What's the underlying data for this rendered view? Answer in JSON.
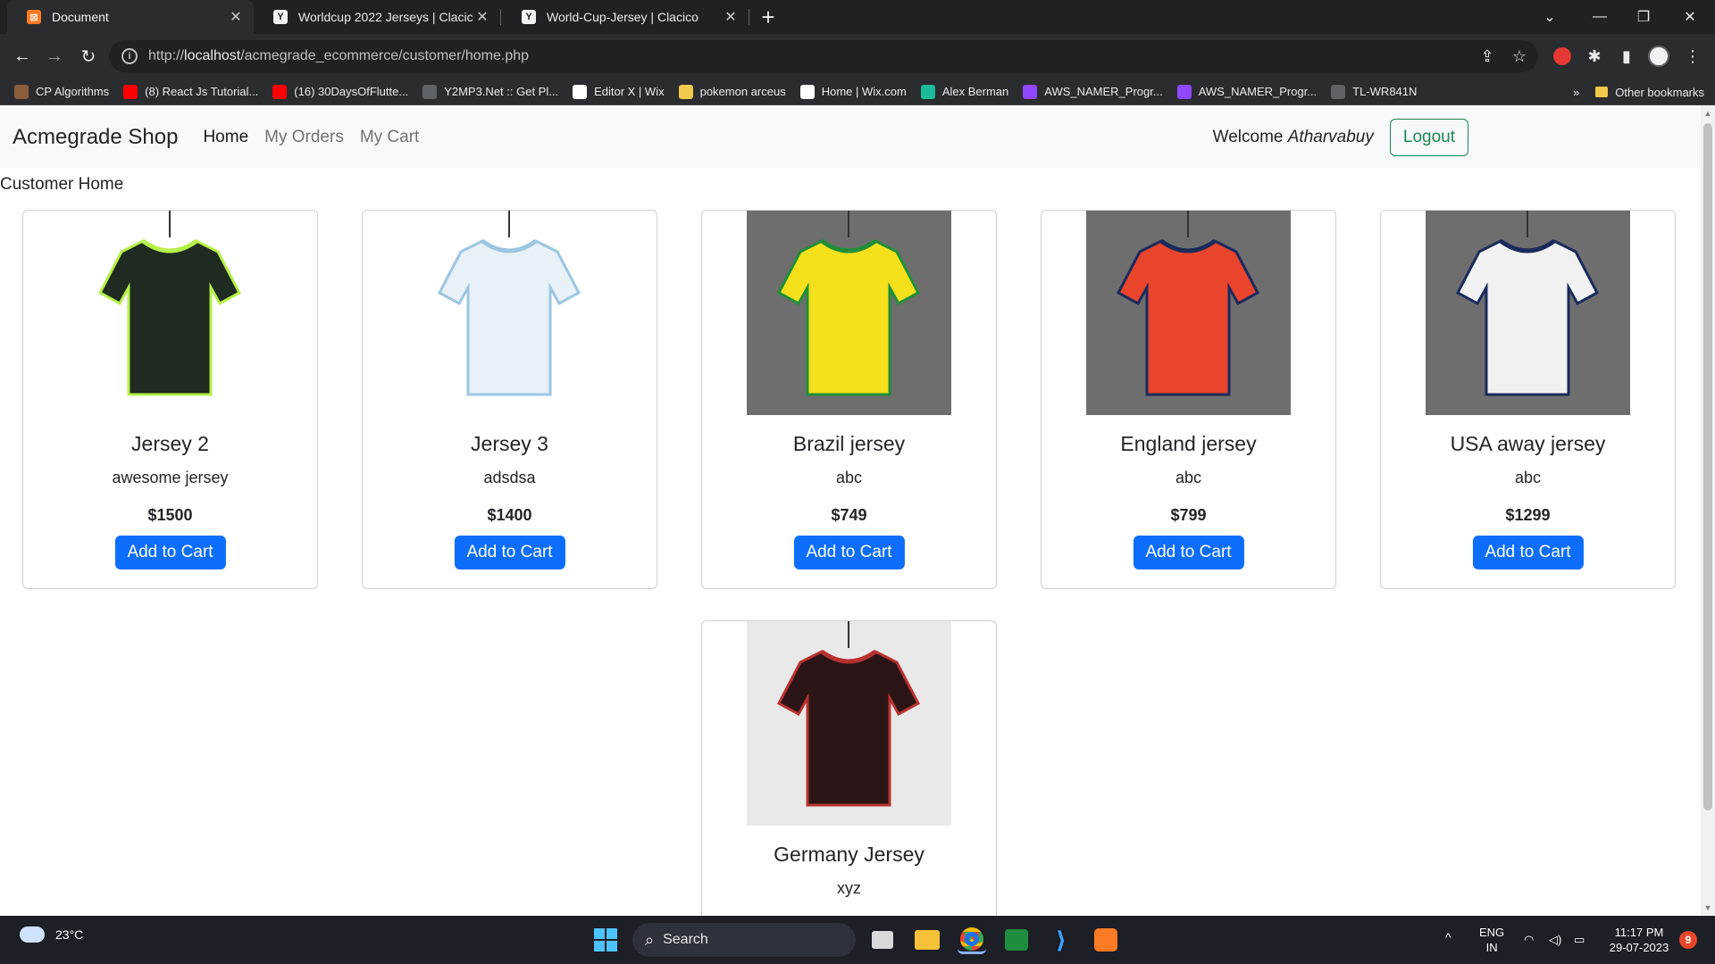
{
  "browser": {
    "tabs": [
      {
        "title": "Document",
        "favicon": "xampp-icon",
        "active": true
      },
      {
        "title": "Worldcup 2022 Jerseys | Clacico",
        "favicon": "clacico-icon",
        "active": false
      },
      {
        "title": "World-Cup-Jersey | Clacico",
        "favicon": "clacico-icon",
        "active": false
      }
    ],
    "url_prefix": "http://",
    "url_host": "localhost",
    "url_path": "/acmegrade_ecommerce/customer/home.php",
    "bookmarks": [
      {
        "label": "CP Algorithms",
        "icon": "cp-icon",
        "color": "#8b5e3c"
      },
      {
        "label": "(8) React Js Tutorial...",
        "icon": "youtube-icon",
        "color": "#ff0000"
      },
      {
        "label": "(16) 30DaysOfFlutte...",
        "icon": "youtube-icon",
        "color": "#ff0000"
      },
      {
        "label": "Y2MP3.Net :: Get Pl...",
        "icon": "globe-icon",
        "color": "#5f6368"
      },
      {
        "label": "Editor X | Wix",
        "icon": "wix-icon",
        "color": "#ffffff"
      },
      {
        "label": "pokemon arceus",
        "icon": "folder-icon",
        "color": "#f2c94c"
      },
      {
        "label": "Home | Wix.com",
        "icon": "wix-icon",
        "color": "#ffffff"
      },
      {
        "label": "Alex Berman",
        "icon": "alex-icon",
        "color": "#1abc9c"
      },
      {
        "label": "AWS_NAMER_Progr...",
        "icon": "twitch-icon",
        "color": "#9146ff"
      },
      {
        "label": "AWS_NAMER_Progr...",
        "icon": "twitch-icon",
        "color": "#9146ff"
      },
      {
        "label": "TL-WR841N",
        "icon": "globe-icon",
        "color": "#5f6368"
      }
    ],
    "more_bookmarks": "»",
    "other_bookmarks": "Other bookmarks"
  },
  "page": {
    "brand": "Acmegrade Shop",
    "nav": [
      {
        "label": "Home",
        "active": true
      },
      {
        "label": "My Orders",
        "active": false
      },
      {
        "label": "My Cart",
        "active": false
      }
    ],
    "welcome_prefix": "Welcome",
    "username": "Atharvabuy",
    "logout": "Logout",
    "subtitle": "Customer Home",
    "add_to_cart": "Add to Cart",
    "accent_color": "#0d6efd",
    "products": [
      {
        "name": "Jersey 2",
        "desc": "awesome jersey",
        "price": "$1500",
        "shirt": "#1f2a20",
        "trim": "#b6f04a",
        "bg": "#ffffff"
      },
      {
        "name": "Jersey 3",
        "desc": "adsdsa",
        "price": "$1400",
        "shirt": "#e8f1f8",
        "trim": "#9cc6e3",
        "bg": "#ffffff"
      },
      {
        "name": "Brazil jersey",
        "desc": "abc",
        "price": "$749",
        "shirt": "#f4e01b",
        "trim": "#1f8f3a",
        "bg": "#6e6e6e"
      },
      {
        "name": "England jersey",
        "desc": "abc",
        "price": "$799",
        "shirt": "#e8452c",
        "trim": "#1b2a5c",
        "bg": "#6e6e6e"
      },
      {
        "name": "USA away jersey",
        "desc": "abc",
        "price": "$1299",
        "shirt": "#f1f1f1",
        "trim": "#1b2a5c",
        "bg": "#6e6e6e"
      },
      {
        "name": "Germany Jersey",
        "desc": "xyz",
        "price": "",
        "shirt": "#2a1416",
        "trim": "#b8322f",
        "bg": "#e9e9e9"
      }
    ]
  },
  "taskbar": {
    "temperature": "23°C",
    "search": "Search",
    "lang": "ENG",
    "region": "IN",
    "time": "11:17 PM",
    "date": "29-07-2023",
    "notifications": "9"
  }
}
